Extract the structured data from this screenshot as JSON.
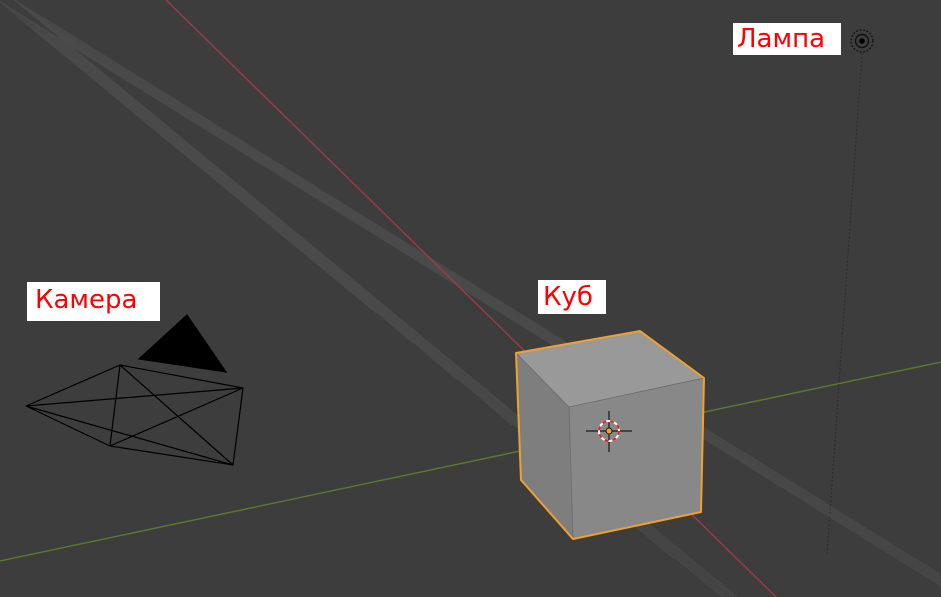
{
  "viewport": {
    "labels": {
      "lamp": "Лампа",
      "camera": "Камера",
      "cube": "Куб"
    },
    "colors": {
      "background": "#3d3d3d",
      "grid": "#4b4b4b",
      "x_axis": "#9b3b48",
      "y_axis": "#5c7a2b",
      "selection": "#f0a030",
      "label_text": "#ff0000",
      "label_bg": "#ffffff"
    },
    "objects": [
      {
        "name": "camera",
        "icon": "camera-wireframe-icon"
      },
      {
        "name": "cube",
        "icon": "selected-cube-icon"
      },
      {
        "name": "lamp",
        "icon": "lamp-icon"
      },
      {
        "name": "origin",
        "icon": "3d-cursor-icon"
      }
    ]
  }
}
